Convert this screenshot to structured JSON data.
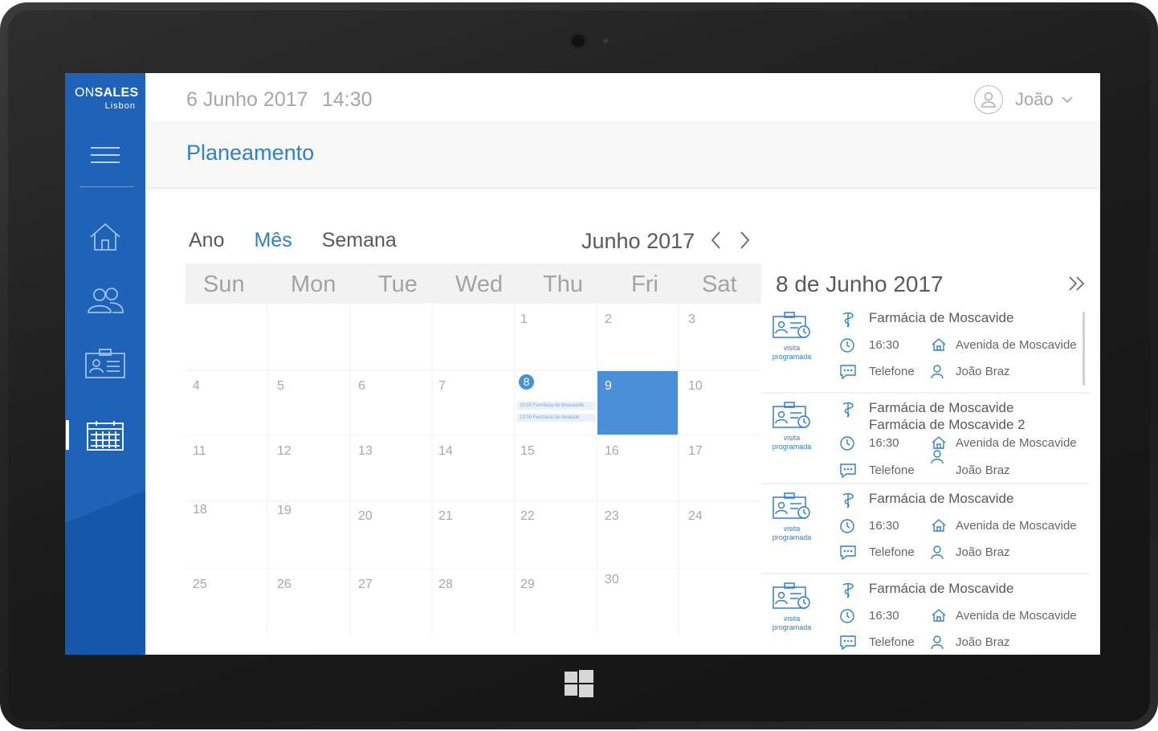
{
  "app": {
    "brand_on": "ON",
    "brand_sales": "SALES",
    "city": "Lisbon"
  },
  "header": {
    "date": "6 Junho 2017",
    "time": "14:30",
    "user": "João"
  },
  "page": {
    "title": "Planeamento"
  },
  "sidebar": {
    "items": [
      {
        "icon": "menu-icon"
      },
      {
        "icon": "home-icon"
      },
      {
        "icon": "users-icon"
      },
      {
        "icon": "contact-card-icon"
      },
      {
        "icon": "calendar-icon",
        "active": true
      }
    ]
  },
  "views": {
    "ano": "Ano",
    "mes": "Mês",
    "semana": "Semana",
    "active": "Mês"
  },
  "calendar": {
    "month_label": "Junho 2017",
    "weekdays": [
      "Sun",
      "Mon",
      "Tue",
      "Wed",
      "Thu",
      "Fri",
      "Sat"
    ],
    "weeks": [
      [
        "",
        "",
        "",
        "",
        "1",
        "2",
        "3"
      ],
      [
        "4",
        "5",
        "6",
        "7",
        "8",
        "9",
        "10"
      ],
      [
        "11",
        "12",
        "13",
        "14",
        "15",
        "16",
        "17"
      ],
      [
        "18",
        "19",
        "20",
        "21",
        "22",
        "23",
        "24"
      ],
      [
        "25",
        "26",
        "27",
        "28",
        "29",
        "30",
        ""
      ]
    ],
    "today": "8",
    "selected": "9",
    "events_on_8": [
      "10:00  Farmácia de Moscavide ...",
      "12:00  Farmácia de Alvalade"
    ]
  },
  "accent_color": "#2f7fcf",
  "panel": {
    "title": "8 de Junho 2017",
    "visit_label_1": "visita",
    "visit_label_2": "programada",
    "cards": [
      {
        "names": [
          "Farmácia de Moscavide"
        ],
        "time": "16:30",
        "address": "Avenida de Moscavide",
        "channel": "Telefone",
        "person": "João Braz"
      },
      {
        "names": [
          "Farmácia de Moscavide",
          "Farmácia de Moscavide 2"
        ],
        "time": "16:30",
        "address": "Avenida de Moscavide",
        "channel": "Telefone",
        "person": "João Braz"
      },
      {
        "names": [
          "Farmácia de Moscavide"
        ],
        "time": "16:30",
        "address": "Avenida de Moscavide",
        "channel": "Telefone",
        "person": "João Braz"
      },
      {
        "names": [
          "Farmácia de Moscavide"
        ],
        "time": "16:30",
        "address": "Avenida de Moscavide",
        "channel": "Telefone",
        "person": "João Braz"
      }
    ]
  }
}
